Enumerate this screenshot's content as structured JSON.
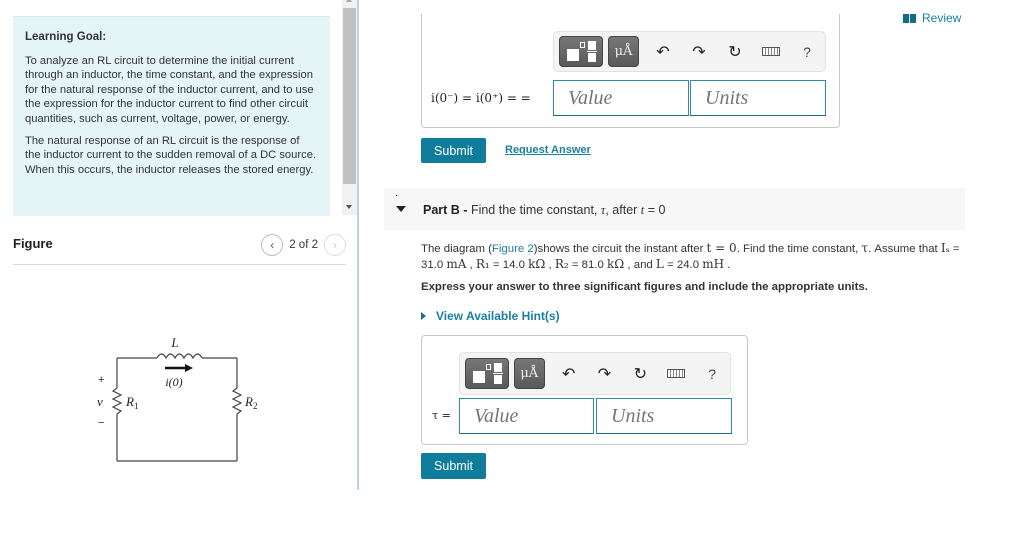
{
  "learning_goal": {
    "title": "Learning Goal:",
    "paragraphs": [
      "To analyze an RL circuit to determine the initial current through an inductor, the time constant, and the expression for the natural response of the inductor current, and to use the expression for the inductor current to find other circuit quantities, such as current, voltage, power, or energy.",
      "The natural response of an RL circuit is the response of the inductor current to the sudden removal of a DC source. When this occurs, the inductor releases the stored energy."
    ]
  },
  "figure": {
    "title": "Figure",
    "pager_text": "2 of 2",
    "prev_icon": "chevron-left-icon",
    "next_icon": "chevron-right-icon",
    "circuit_labels": {
      "inductor": "L",
      "current": "i(0)",
      "plus": "+",
      "voltage": "v",
      "minus": "−",
      "r1": "R",
      "r1_sub": "1",
      "r2": "R",
      "r2_sub": "2"
    }
  },
  "header": {
    "review_label": "Review",
    "review_icon": "book-icon"
  },
  "part_a": {
    "equation_label": "i(0⁻) = i(0⁺) = =",
    "value_placeholder": "Value",
    "units_placeholder": "Units",
    "submit_label": "Submit",
    "request_answer_label": "Request Answer"
  },
  "toolbar": {
    "templates_icon": "templates-icon",
    "units_label": "μÅ",
    "undo": "↶",
    "redo": "↷",
    "reset": "↻",
    "help": "?"
  },
  "part_b": {
    "label": "Part B",
    "separator": " - ",
    "title_prefix": "Find the time constant, ",
    "tau": "τ",
    "title_mid": ", after ",
    "t": "t",
    "title_suffix": " = 0",
    "problem_prefix": "The diagram (",
    "figure_link": "Figure 2",
    "problem_mid": ")shows the circuit the instant after ",
    "problem_t0": "t = 0",
    "problem_mid2": ". Find the time constant, ",
    "problem_tau": "τ",
    "problem_mid3": ". Assume that ",
    "Is_label": "Iₛ",
    "Is_value": " = 31.0 ",
    "Is_unit": "mA",
    "R1_label": "R₁",
    "R1_value": " = 14.0 ",
    "R1_unit": "kΩ",
    "R2_label": "R₂",
    "R2_value": " = 81.0 ",
    "R2_unit": "kΩ",
    "L_label": "L",
    "L_value": " = 24.0 ",
    "L_unit": "mH",
    "instruction": "Express your answer to three significant figures and include the appropriate units.",
    "hints_label": "View Available Hint(s)",
    "equation_label": "τ =",
    "value_placeholder": "Value",
    "units_placeholder": "Units",
    "submit_label": "Submit"
  }
}
